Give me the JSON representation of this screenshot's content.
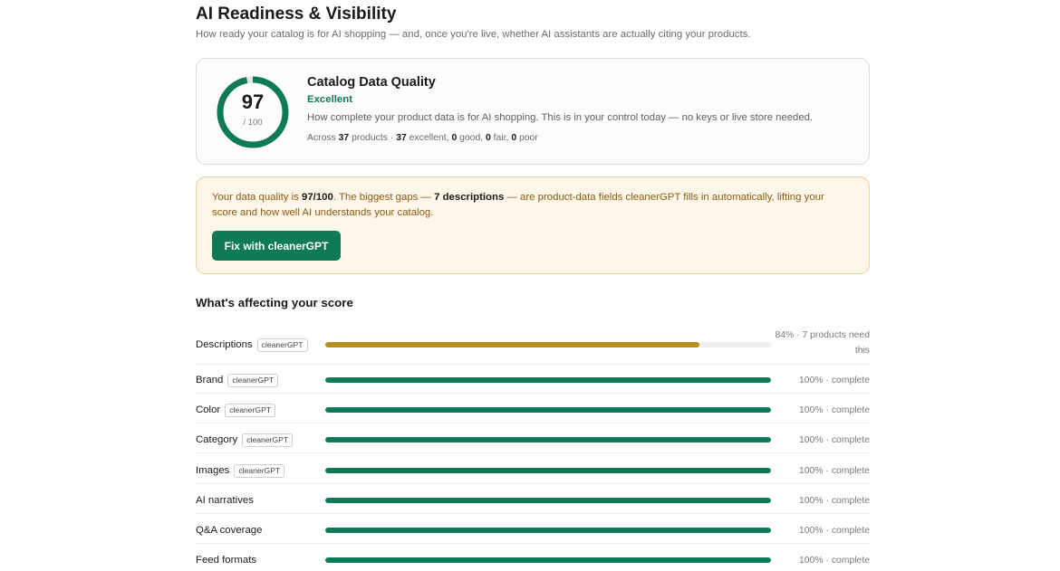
{
  "page": {
    "title": "AI Readiness & Visibility",
    "subtitle": "How ready your catalog is for AI shopping — and, once you're live, whether AI assistants are actually citing your products."
  },
  "score_card": {
    "score": "97",
    "score_value": 97,
    "max_label": "/ 100",
    "title": "Catalog Data Quality",
    "status": "Excellent",
    "description": "How complete your product data is for AI shopping. This is in your control today — no keys or live store needed.",
    "stats": {
      "prefix": "Across ",
      "products": "37",
      "products_suffix": " products · ",
      "excellent": "37",
      "excellent_suffix": " excellent, ",
      "good": "0",
      "good_suffix": " good, ",
      "fair": "0",
      "fair_suffix": " fair, ",
      "poor": "0",
      "poor_suffix": " poor"
    }
  },
  "callout": {
    "text_1": "Your data quality is ",
    "score_bold": "97/100",
    "text_2": ". The biggest gaps — ",
    "gap_bold": "7 descriptions",
    "text_3": " — are product-data fields cleanerGPT fills in automatically, lifting your score and how well AI understands your catalog.",
    "button_label": "Fix with cleanerGPT"
  },
  "factors_section": {
    "title": "What's affecting your score",
    "items": [
      {
        "label": "Descriptions",
        "tag": "cleanerGPT",
        "percent": 84,
        "meta": "84% · 7 products need this"
      },
      {
        "label": "Brand",
        "tag": "cleanerGPT",
        "percent": 100,
        "meta": "100% · complete"
      },
      {
        "label": "Color",
        "tag": "cleanerGPT",
        "percent": 100,
        "meta": "100% · complete"
      },
      {
        "label": "Category",
        "tag": "cleanerGPT",
        "percent": 100,
        "meta": "100% · complete"
      },
      {
        "label": "Images",
        "tag": "cleanerGPT",
        "percent": 100,
        "meta": "100% · complete"
      },
      {
        "label": "AI narratives",
        "tag": "",
        "percent": 100,
        "meta": "100% · complete"
      },
      {
        "label": "Q&A coverage",
        "tag": "",
        "percent": 100,
        "meta": "100% · complete"
      },
      {
        "label": "Feed formats",
        "tag": "",
        "percent": 100,
        "meta": "100% · complete"
      }
    ]
  },
  "colors": {
    "accent": "#0f7a56",
    "warning_bar": "#b8901f",
    "track": "#eeeeee"
  }
}
